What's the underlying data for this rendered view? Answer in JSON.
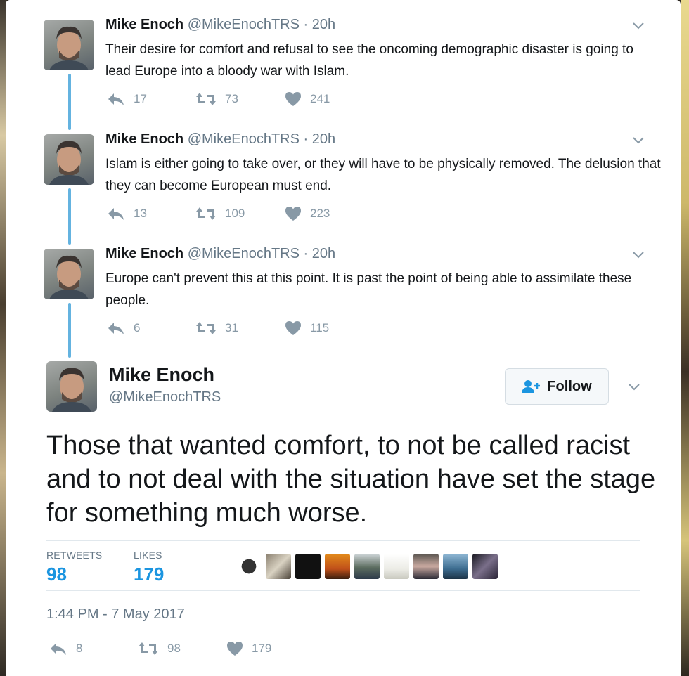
{
  "thread": [
    {
      "name": "Mike Enoch",
      "handle": "@MikeEnochTRS",
      "separator": "·",
      "time": "20h",
      "text": "Their desire for comfort and refusal to see the oncoming demographic disaster is going to lead Europe into a bloody war with Islam.",
      "replies": "17",
      "retweets": "73",
      "likes": "241"
    },
    {
      "name": "Mike Enoch",
      "handle": "@MikeEnochTRS",
      "separator": "·",
      "time": "20h",
      "text": "Islam is either going to take over, or they will have to be physically removed. The delusion that they can become European must end.",
      "replies": "13",
      "retweets": "109",
      "likes": "223"
    },
    {
      "name": "Mike Enoch",
      "handle": "@MikeEnochTRS",
      "separator": "·",
      "time": "20h",
      "text": "Europe can't prevent this at this point. It is past the point of being able to assimilate these people.",
      "replies": "6",
      "retweets": "31",
      "likes": "115"
    }
  ],
  "main": {
    "name": "Mike Enoch",
    "handle": "@MikeEnochTRS",
    "follow_label": "Follow",
    "text": "Those that wanted comfort, to not be called racist and to not deal with the situation have set the stage for something much worse.",
    "stats": {
      "retweets_label": "RETWEETS",
      "retweets_value": "98",
      "likes_label": "LIKES",
      "likes_value": "179"
    },
    "timestamp": "1:44 PM - 7 May 2017",
    "replies": "8",
    "retweets": "98",
    "likes": "179"
  },
  "icons": {
    "reply": "reply-icon",
    "retweet": "retweet-icon",
    "like": "heart-icon",
    "caret": "chevron-down-icon",
    "follow": "add-user-icon"
  },
  "colors": {
    "accent": "#1b95e0",
    "thread_line": "#64b3e0",
    "icon_gray": "#8899a6"
  }
}
